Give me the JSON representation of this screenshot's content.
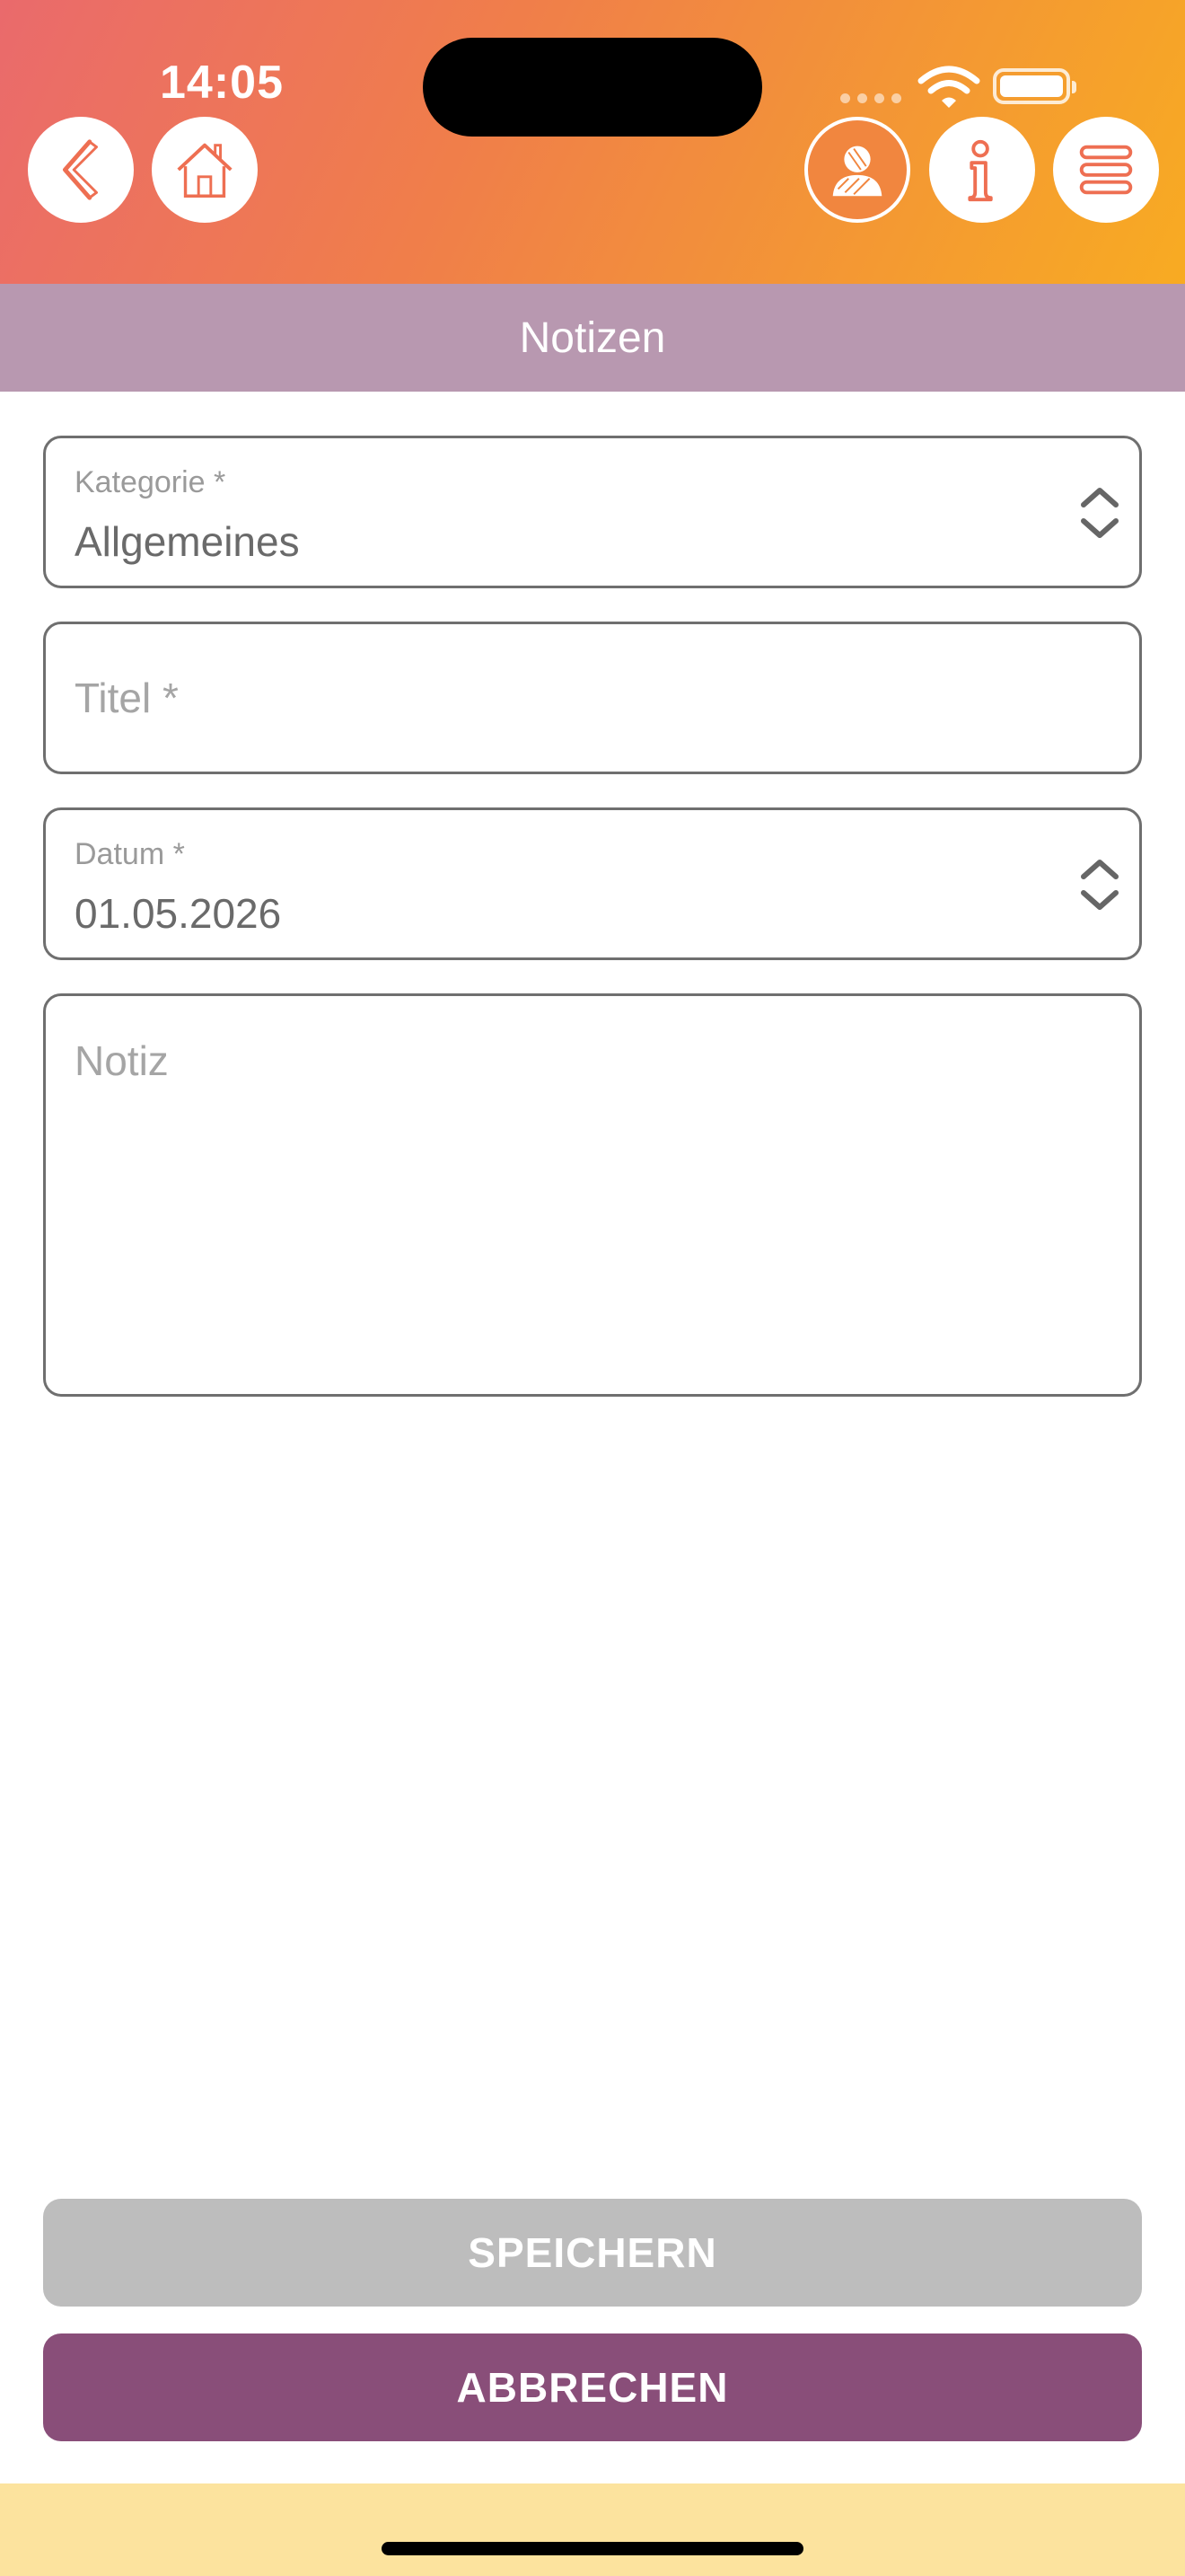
{
  "status_bar": {
    "time": "14:05"
  },
  "header": {
    "buttons": [
      {
        "name": "back",
        "icon": "back-arrow-icon"
      },
      {
        "name": "home",
        "icon": "home-icon"
      },
      {
        "name": "profile",
        "icon": "user-icon"
      },
      {
        "name": "info",
        "icon": "info-icon"
      },
      {
        "name": "menu",
        "icon": "menu-icon"
      }
    ]
  },
  "page": {
    "title": "Notizen"
  },
  "form": {
    "kategorie": {
      "label": "Kategorie *",
      "value": "Allgemeines"
    },
    "titel": {
      "placeholder": "Titel *"
    },
    "datum": {
      "label": "Datum *",
      "value": "01.05.2026"
    },
    "notiz": {
      "placeholder": "Notiz"
    }
  },
  "actions": {
    "save_label": "SPEICHERN",
    "cancel_label": "ABBRECHEN"
  },
  "colors": {
    "header_gradient_start": "#ea6a6c",
    "header_gradient_end": "#f8ab22",
    "title_bar": "#b898b0",
    "cancel_button": "#894e79",
    "save_button_disabled": "#bdbdbd",
    "bottom_bar": "#fce39e"
  }
}
